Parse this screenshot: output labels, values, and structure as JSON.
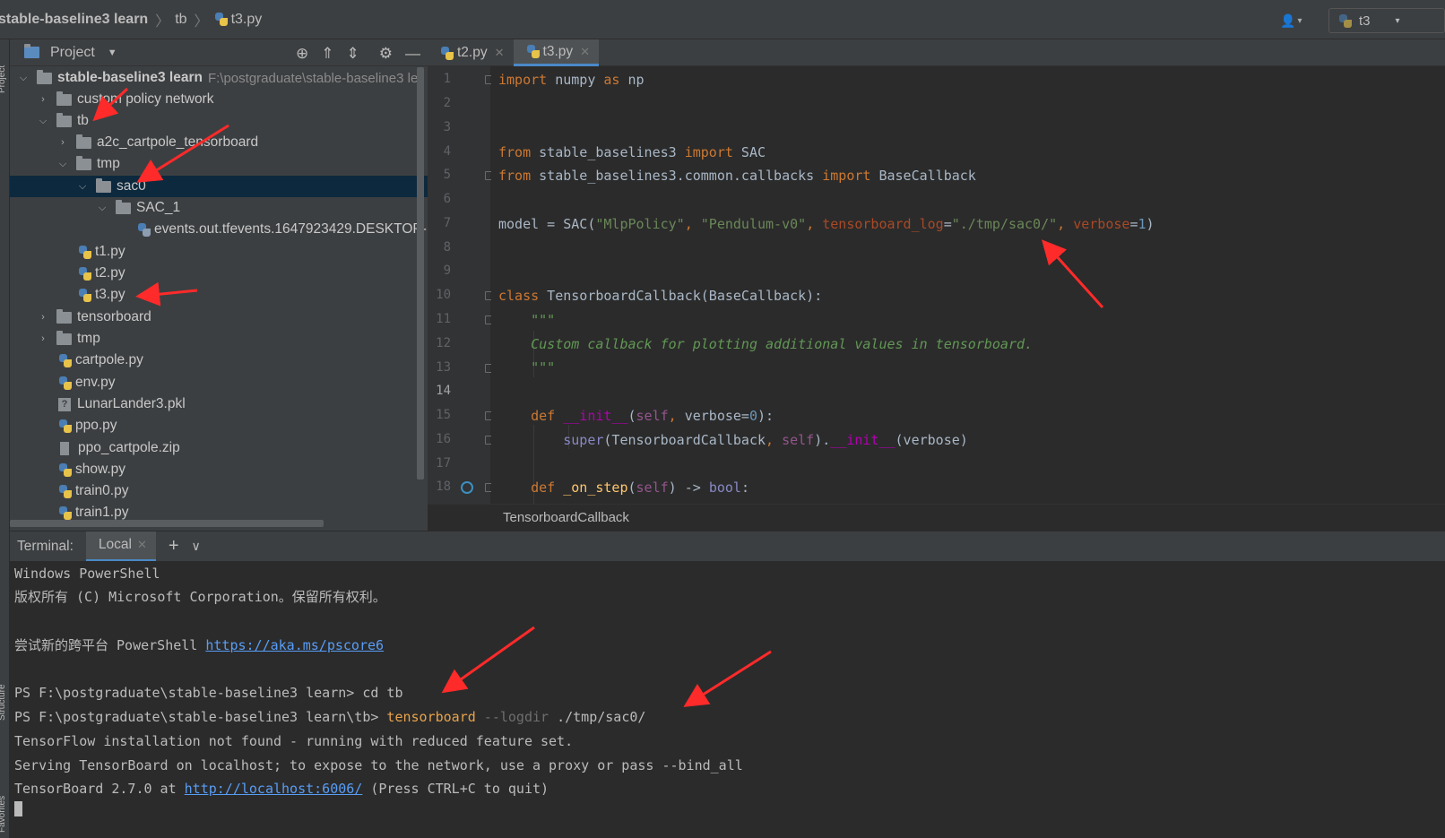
{
  "navbar": {
    "project": "stable-baseline3 learn",
    "folder": "tb",
    "file": "t3.py",
    "run_config": "t3"
  },
  "left_stripe": {
    "project_label": "Project",
    "structure_label": "Structure",
    "favorites_label": "Favorites"
  },
  "project_panel": {
    "title": "Project",
    "tree": [
      {
        "label": "stable-baseline3 learn",
        "path": "F:\\postgraduate\\stable-baseline3 le",
        "type": "folder",
        "expanded": true
      },
      {
        "label": "custom policy network",
        "type": "folder",
        "expanded": false
      },
      {
        "label": "tb",
        "type": "folder",
        "expanded": true
      },
      {
        "label": "a2c_cartpole_tensorboard",
        "type": "folder",
        "expanded": false
      },
      {
        "label": "tmp",
        "type": "folder",
        "expanded": true
      },
      {
        "label": "sac0",
        "type": "folder",
        "expanded": true,
        "selected": true
      },
      {
        "label": "SAC_1",
        "type": "folder",
        "expanded": true
      },
      {
        "label": "events.out.tfevents.1647923429.DESKTOP-",
        "type": "file"
      },
      {
        "label": "t1.py",
        "type": "python"
      },
      {
        "label": "t2.py",
        "type": "python"
      },
      {
        "label": "t3.py",
        "type": "python"
      },
      {
        "label": "tensorboard",
        "type": "folder",
        "expanded": false
      },
      {
        "label": "tmp",
        "type": "folder",
        "expanded": false
      },
      {
        "label": "cartpole.py",
        "type": "python"
      },
      {
        "label": "env.py",
        "type": "python"
      },
      {
        "label": "LunarLander3.pkl",
        "type": "pkl"
      },
      {
        "label": "ppo.py",
        "type": "python"
      },
      {
        "label": "ppo_cartpole.zip",
        "type": "zip"
      },
      {
        "label": "show.py",
        "type": "python"
      },
      {
        "label": "train0.py",
        "type": "python"
      },
      {
        "label": "train1.py",
        "type": "python"
      }
    ]
  },
  "editor": {
    "tabs": [
      {
        "label": "t2.py",
        "active": false
      },
      {
        "label": "t3.py",
        "active": true
      }
    ],
    "current_line": 14,
    "breadcrumb": "TensorboardCallback",
    "line_numbers": [
      "1",
      "2",
      "3",
      "4",
      "5",
      "6",
      "7",
      "8",
      "9",
      "10",
      "11",
      "12",
      "13",
      "14",
      "15",
      "16",
      "17",
      "18"
    ]
  },
  "terminal": {
    "label": "Terminal:",
    "tab": "Local",
    "lines": {
      "l1": "Windows PowerShell",
      "l2": "版权所有 (C) Microsoft Corporation。保留所有权利。",
      "l4_prefix": "尝试新的跨平台 PowerShell ",
      "l4_link": "https://aka.ms/pscore6",
      "l6": "PS F:\\postgraduate\\stable-baseline3 learn> cd tb",
      "l7_prompt": "PS F:\\postgraduate\\stable-baseline3 learn\\tb> ",
      "l7_cmd": "tensorboard",
      "l7_flag": " --logdir",
      "l7_arg": " ./tmp/sac0/",
      "l8": "TensorFlow installation not found - running with reduced feature set.",
      "l9": "Serving TensorBoard on localhost; to expose to the network, use a proxy or pass --bind_all",
      "l10_prefix": "TensorBoard 2.7.0 at ",
      "l10_link": "http://localhost:6006/",
      "l10_suffix": " (Press CTRL+C to quit)"
    }
  },
  "colors": {
    "annotation_arrow": "#ff2a2a",
    "selection": "#0d293e",
    "accent": "#4a88c7"
  }
}
